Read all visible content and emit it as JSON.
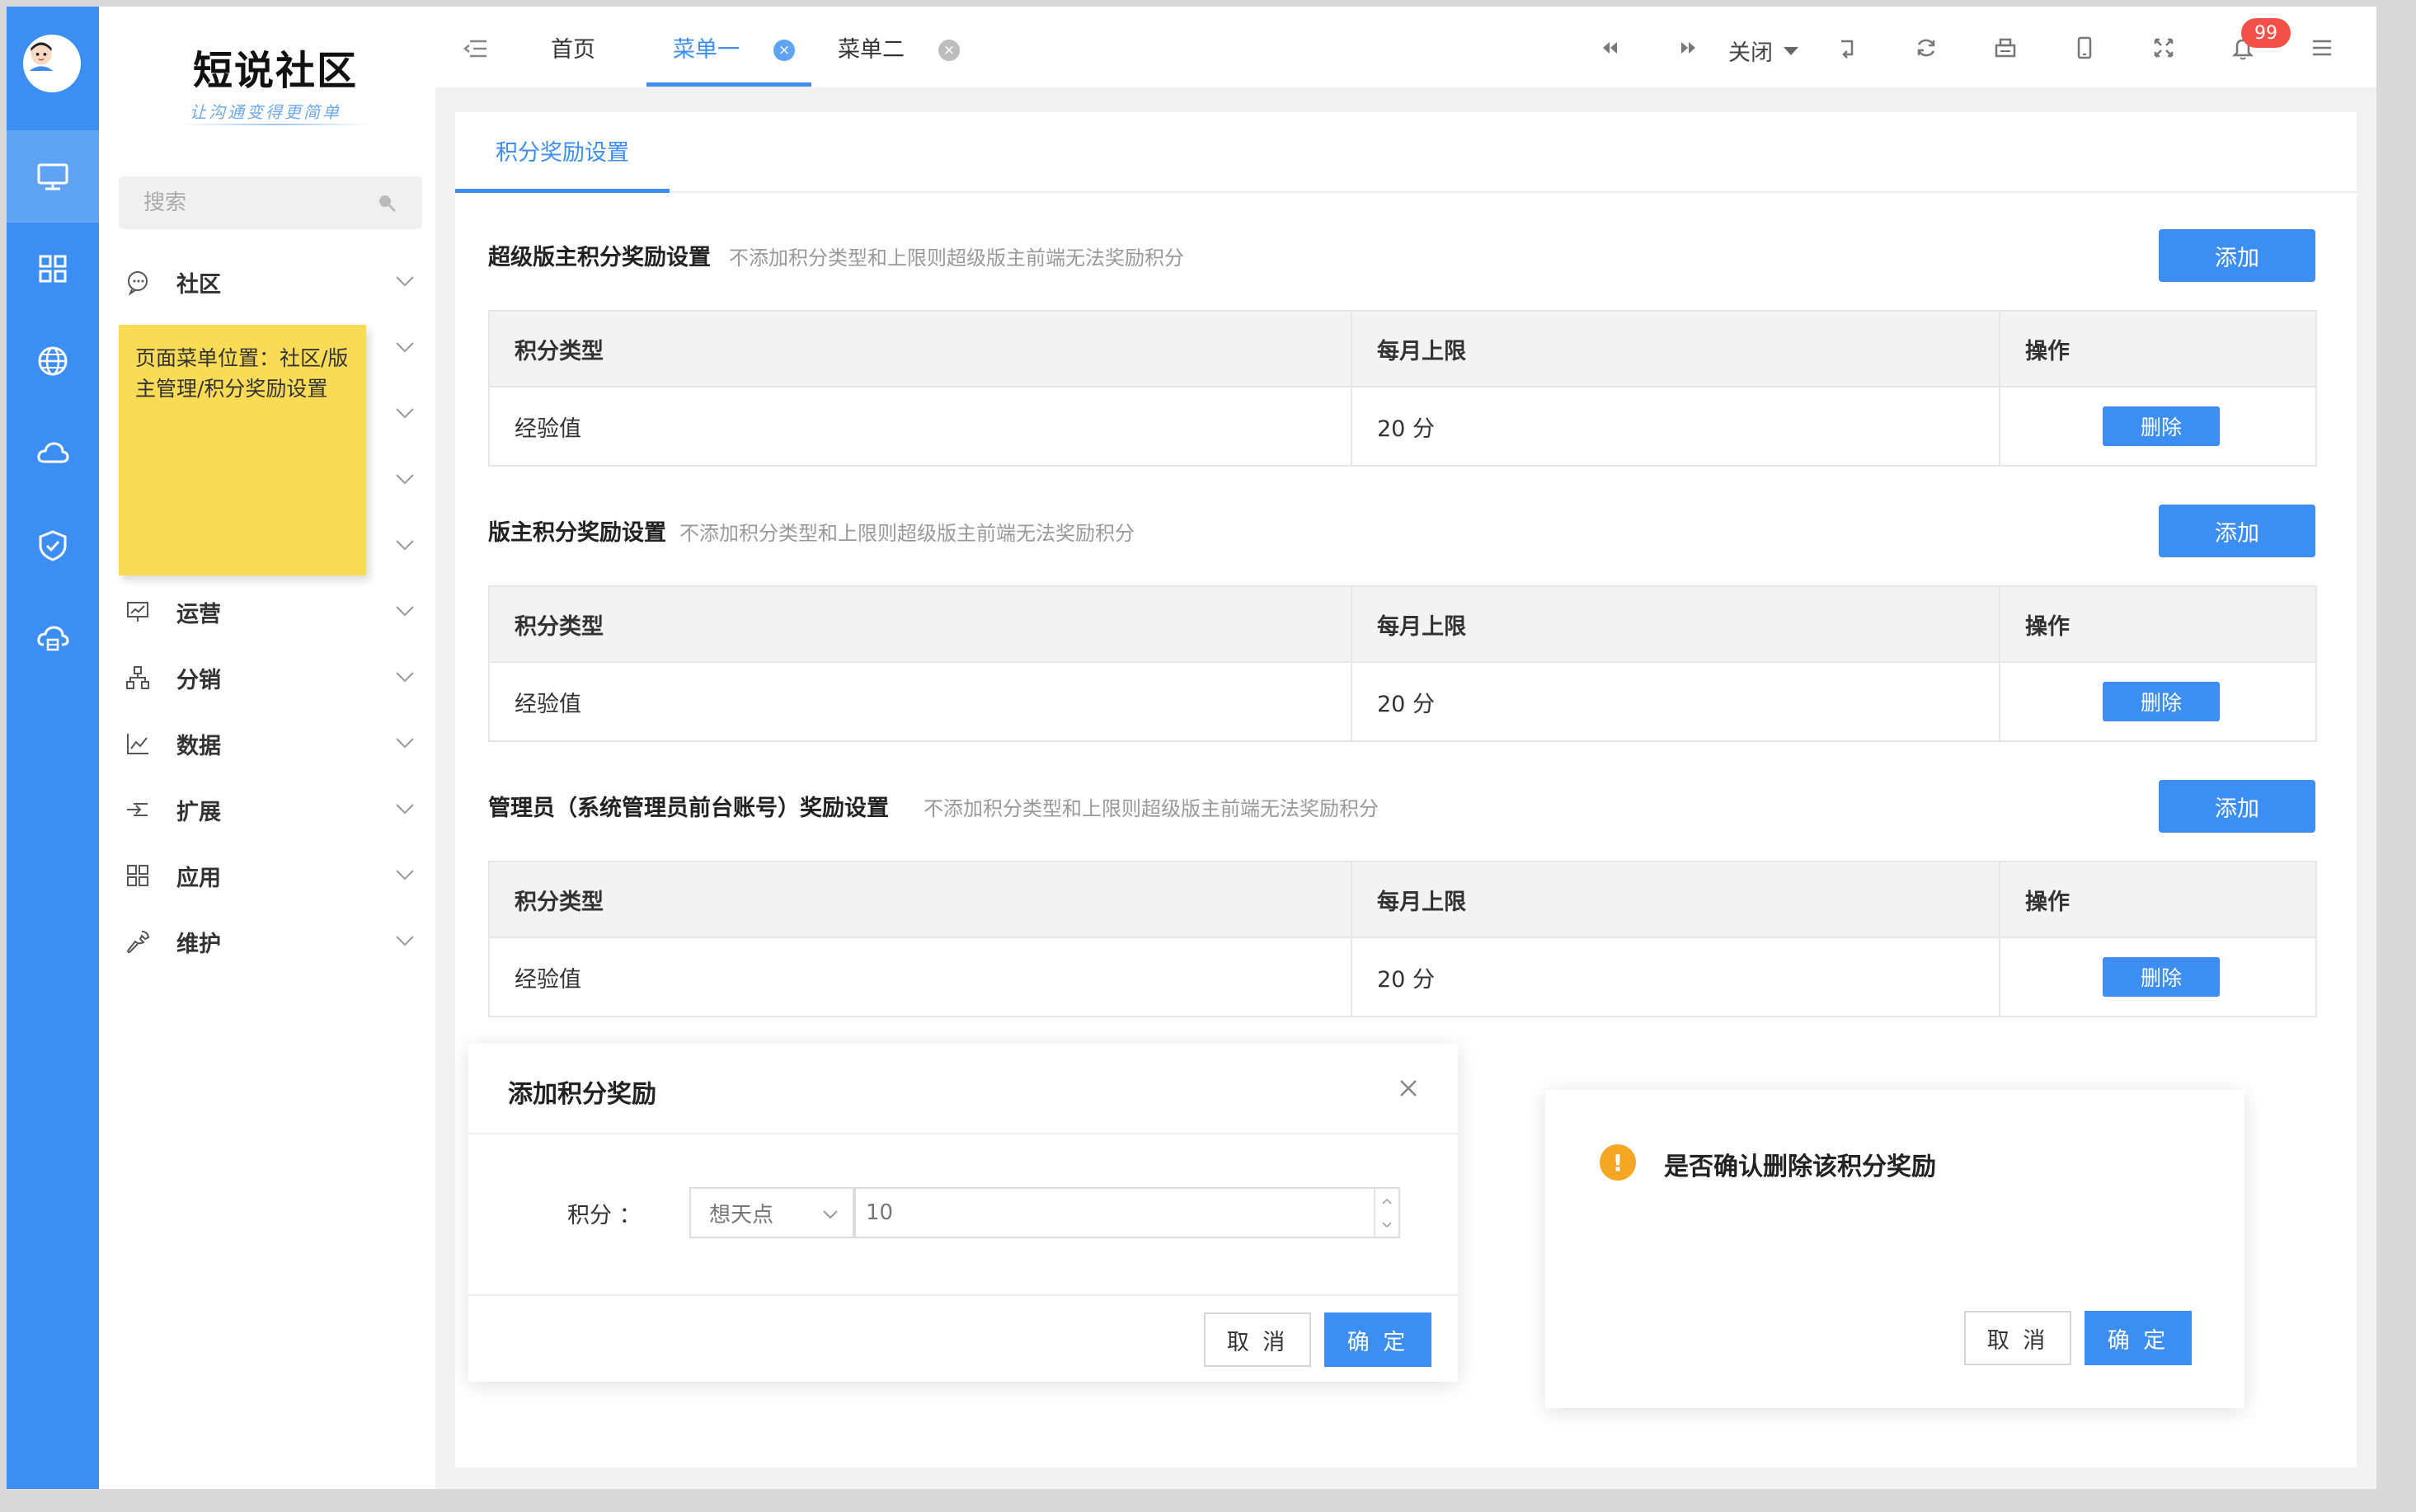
{
  "brand": {
    "logo_title": "短说社区",
    "logo_slogan": "让沟通变得更简单"
  },
  "rail": {
    "items": [
      {
        "icon": "monitor-icon",
        "active": true
      },
      {
        "icon": "grid-icon",
        "active": false
      },
      {
        "icon": "globe-icon",
        "active": false
      },
      {
        "icon": "cloud-icon",
        "active": false
      },
      {
        "icon": "shield-check-icon",
        "active": false
      },
      {
        "icon": "cloud-server-icon",
        "active": false
      }
    ]
  },
  "sidebar": {
    "search_placeholder": "搜索",
    "items": [
      {
        "label": "社区",
        "icon": "chat-icon"
      },
      {
        "label": "运营",
        "icon": "presentation-icon"
      },
      {
        "label": "分销",
        "icon": "org-chart-icon"
      },
      {
        "label": "数据",
        "icon": "line-chart-icon"
      },
      {
        "label": "扩展",
        "icon": "expand-icon"
      },
      {
        "label": "应用",
        "icon": "apps-icon"
      },
      {
        "label": "维护",
        "icon": "wrench-icon"
      }
    ],
    "sticky_note": "页面菜单位置：社区/版主管理/积分奖励设置"
  },
  "topbar": {
    "tabs": [
      {
        "label": "首页",
        "active": false
      },
      {
        "label": "菜单一",
        "active": true
      },
      {
        "label": "菜单二",
        "active": false
      }
    ],
    "close_label": "关闭",
    "notification_count": "99"
  },
  "content": {
    "tab_label": "积分奖励设置",
    "sections": [
      {
        "title": "超级版主积分奖励设置",
        "hint": "不添加积分类型和上限则超级版主前端无法奖励积分",
        "add_label": "添加",
        "headers": [
          "积分类型",
          "每月上限",
          "操作"
        ],
        "rows": [
          {
            "type": "经验值",
            "limit": "20 分",
            "action": "删除"
          }
        ]
      },
      {
        "title": "版主积分奖励设置",
        "hint": "不添加积分类型和上限则超级版主前端无法奖励积分",
        "add_label": "添加",
        "headers": [
          "积分类型",
          "每月上限",
          "操作"
        ],
        "rows": [
          {
            "type": "经验值",
            "limit": "20 分",
            "action": "删除"
          }
        ]
      },
      {
        "title": "管理员（系统管理员前台账号）奖励设置",
        "hint": "不添加积分类型和上限则超级版主前端无法奖励积分",
        "add_label": "添加",
        "headers": [
          "积分类型",
          "每月上限",
          "操作"
        ],
        "rows": [
          {
            "type": "经验值",
            "limit": "20 分",
            "action": "删除"
          }
        ]
      }
    ]
  },
  "add_dialog": {
    "title": "添加积分奖励",
    "field_label": "积分 ：",
    "select_value": "想天点",
    "number_value": "10",
    "cancel_label": "取 消",
    "ok_label": "确 定"
  },
  "confirm_dialog": {
    "icon": "!",
    "message": "是否确认删除该积分奖励",
    "cancel_label": "取 消",
    "ok_label": "确 定"
  },
  "colors": {
    "primary": "#3d8ef2",
    "sticky": "#fadb55",
    "warning": "#f5a623",
    "badge": "#f4504a"
  }
}
